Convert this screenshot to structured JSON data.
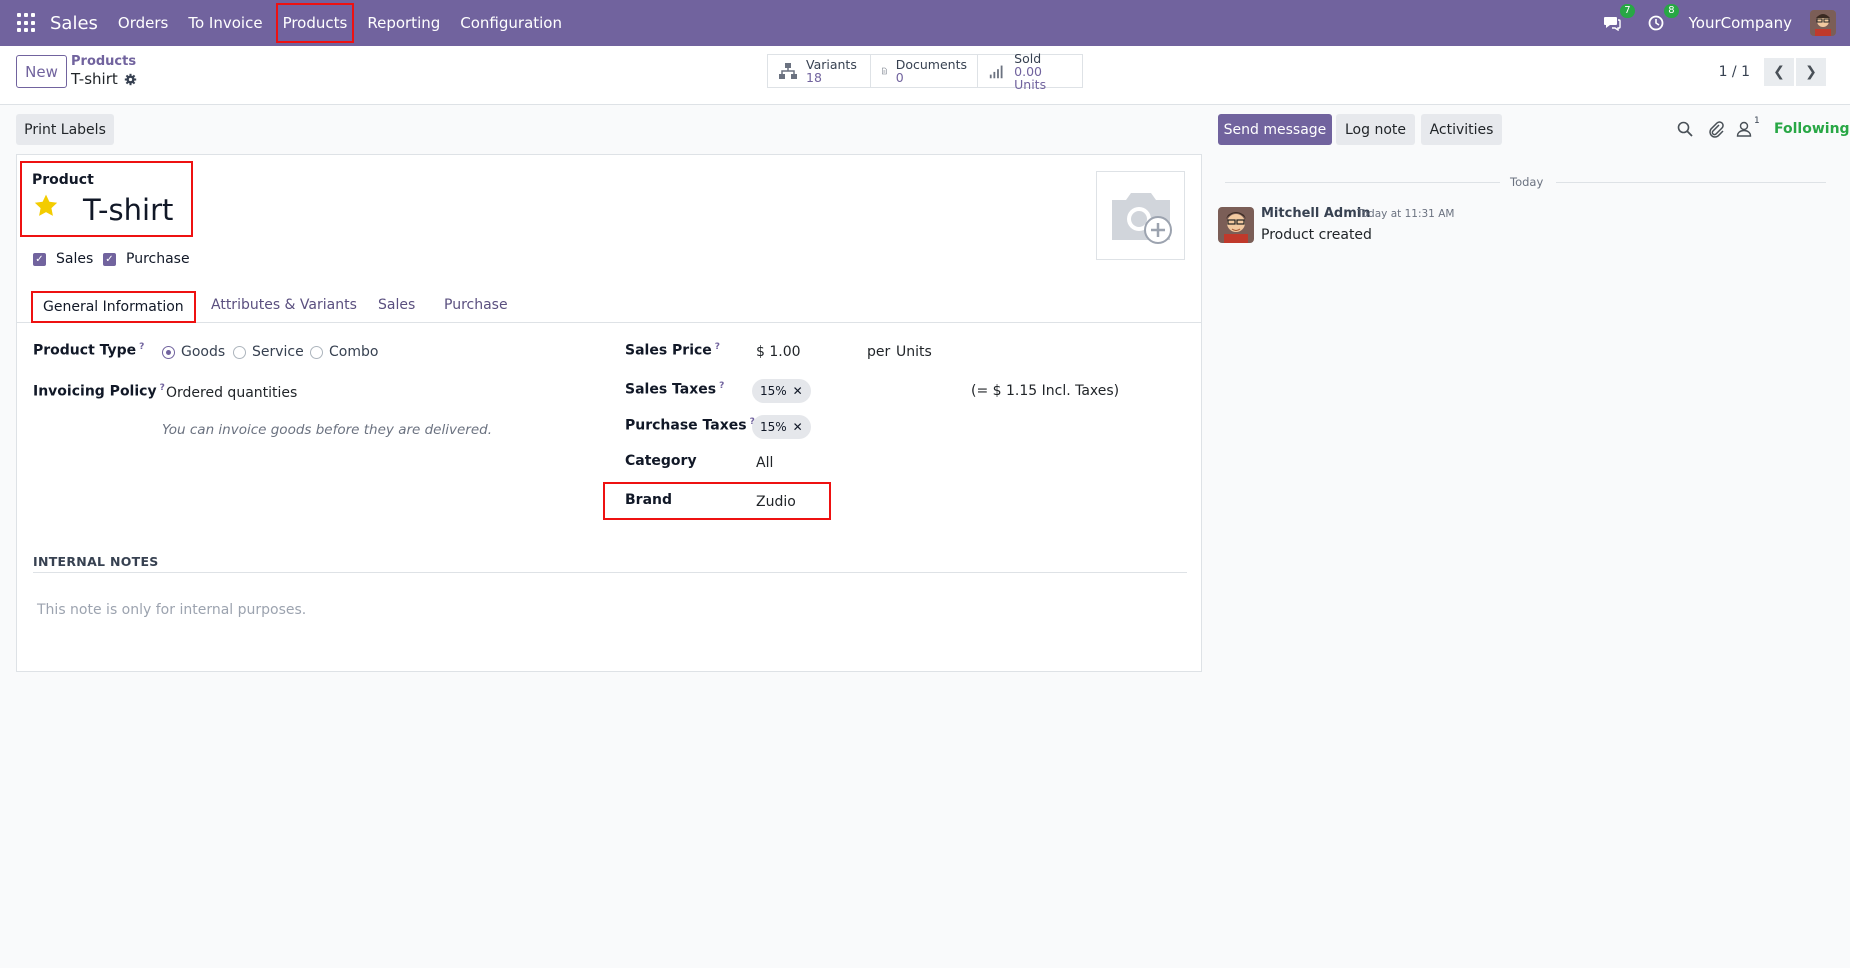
{
  "navbar": {
    "app_name": "Sales",
    "menu": [
      "Orders",
      "To Invoice",
      "Products",
      "Reporting",
      "Configuration"
    ],
    "active_menu": "Products",
    "messages_count": "7",
    "activities_count": "8",
    "company": "YourCompany",
    "bg_color": "#71639e"
  },
  "control": {
    "new_label": "New",
    "breadcrumb_parent": "Products",
    "breadcrumb_current": "T-shirt",
    "smart_buttons": [
      {
        "label": "Variants",
        "value": "18",
        "icon": "variants-icon"
      },
      {
        "label": "Documents",
        "value": "0",
        "icon": "documents-icon"
      },
      {
        "label": "Sold",
        "value": "0.00 Units",
        "icon": "sold-chart-icon"
      }
    ],
    "pager": "1 / 1"
  },
  "actions": {
    "print_labels": "Print Labels"
  },
  "form": {
    "product_label": "Product",
    "product_name": "T-shirt",
    "checkbox_sales": "Sales",
    "checkbox_purchase": "Purchase",
    "tabs": [
      "General Information",
      "Attributes & Variants",
      "Sales",
      "Purchase"
    ],
    "active_tab": "General Information",
    "product_type_label": "Product Type",
    "product_type_options": [
      "Goods",
      "Service",
      "Combo"
    ],
    "product_type_selected": "Goods",
    "invoicing_policy_label": "Invoicing Policy",
    "invoicing_policy_value": "Ordered quantities",
    "invoicing_hint": "You can invoice goods before they are delivered.",
    "sales_price_label": "Sales Price",
    "sales_price_value": "$ 1.00",
    "per_label": "per",
    "uom_value": "Units",
    "sales_taxes_label": "Sales Taxes",
    "sales_taxes_tag": "15%",
    "incl_taxes": "(= $ 1.15 Incl. Taxes)",
    "purchase_taxes_label": "Purchase Taxes",
    "purchase_taxes_tag": "15%",
    "category_label": "Category",
    "category_value": "All",
    "brand_label": "Brand",
    "brand_value": "Zudio",
    "internal_notes_title": "INTERNAL NOTES",
    "internal_notes_placeholder": "This note is only for internal purposes.",
    "help_marker": "?",
    "tag_remove": "✕"
  },
  "chatter": {
    "send_message": "Send message",
    "log_note": "Log note",
    "activities": "Activities",
    "followers_count": "1",
    "following": "Following",
    "date_separator": "Today",
    "message": {
      "author": "Mitchell Admin",
      "date": "Today at 11:31 AM",
      "body": "Product created"
    }
  }
}
